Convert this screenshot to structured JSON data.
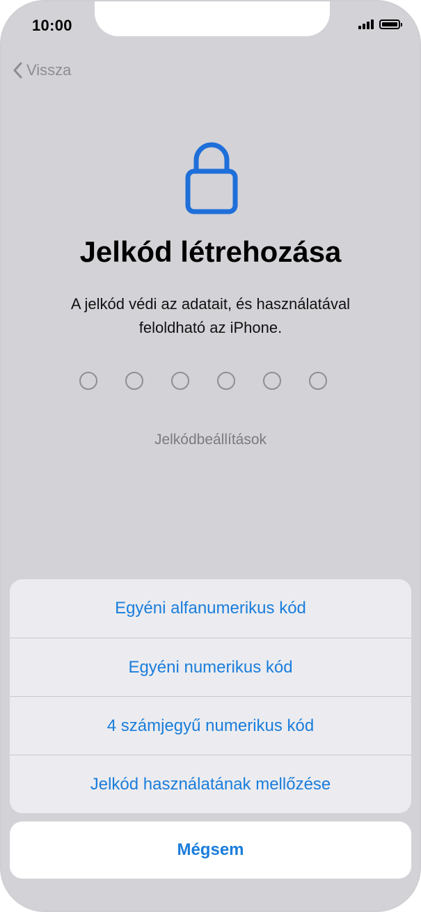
{
  "status_bar": {
    "time": "10:00"
  },
  "nav": {
    "back_label": "Vissza",
    "back_icon": "chevron-left-icon"
  },
  "main": {
    "icon": "lock-icon",
    "title": "Jelkód létrehozása",
    "subtitle": "A jelkód védi az adatait, és használatával feloldható az iPhone.",
    "passcode_digits": 6,
    "options_link": "Jelkódbeállítások"
  },
  "action_sheet": {
    "items": [
      {
        "label": "Egyéni alfanumerikus kód"
      },
      {
        "label": "Egyéni numerikus kód"
      },
      {
        "label": "4 számjegyű numerikus kód"
      },
      {
        "label": "Jelkód használatának mellőzése"
      }
    ],
    "cancel_label": "Mégsem"
  },
  "colors": {
    "accent": "#1a7ddb",
    "dimmed_background": "#d3d2d7",
    "lock_icon": "#1e6fd9"
  }
}
